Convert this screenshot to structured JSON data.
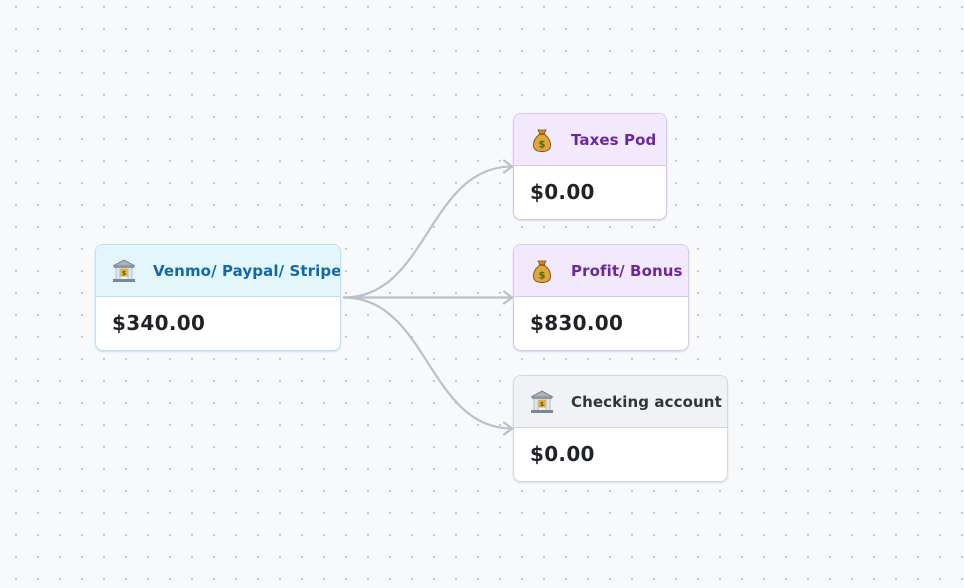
{
  "colors": {
    "edge": "#b9c2cc",
    "source_title": "#1468a4",
    "pod_title": "#6a2996",
    "account_title": "#30353b",
    "amount": "#1f2328"
  },
  "nodes": [
    {
      "id": "source",
      "icon": "bank-icon",
      "title": "Venmo/ Paypal/ Stripe",
      "amount": "$340.00"
    },
    {
      "id": "taxes",
      "icon": "money-bag-icon",
      "title": "Taxes Pod",
      "amount": "$0.00"
    },
    {
      "id": "profit",
      "icon": "money-bag-icon",
      "title": "Profit/ Bonus",
      "amount": "$830.00"
    },
    {
      "id": "checking",
      "icon": "bank-icon",
      "title": "Checking account",
      "amount": "$0.00"
    }
  ],
  "edges": [
    {
      "from": "source",
      "to": "taxes"
    },
    {
      "from": "source",
      "to": "profit"
    },
    {
      "from": "source",
      "to": "checking"
    }
  ]
}
